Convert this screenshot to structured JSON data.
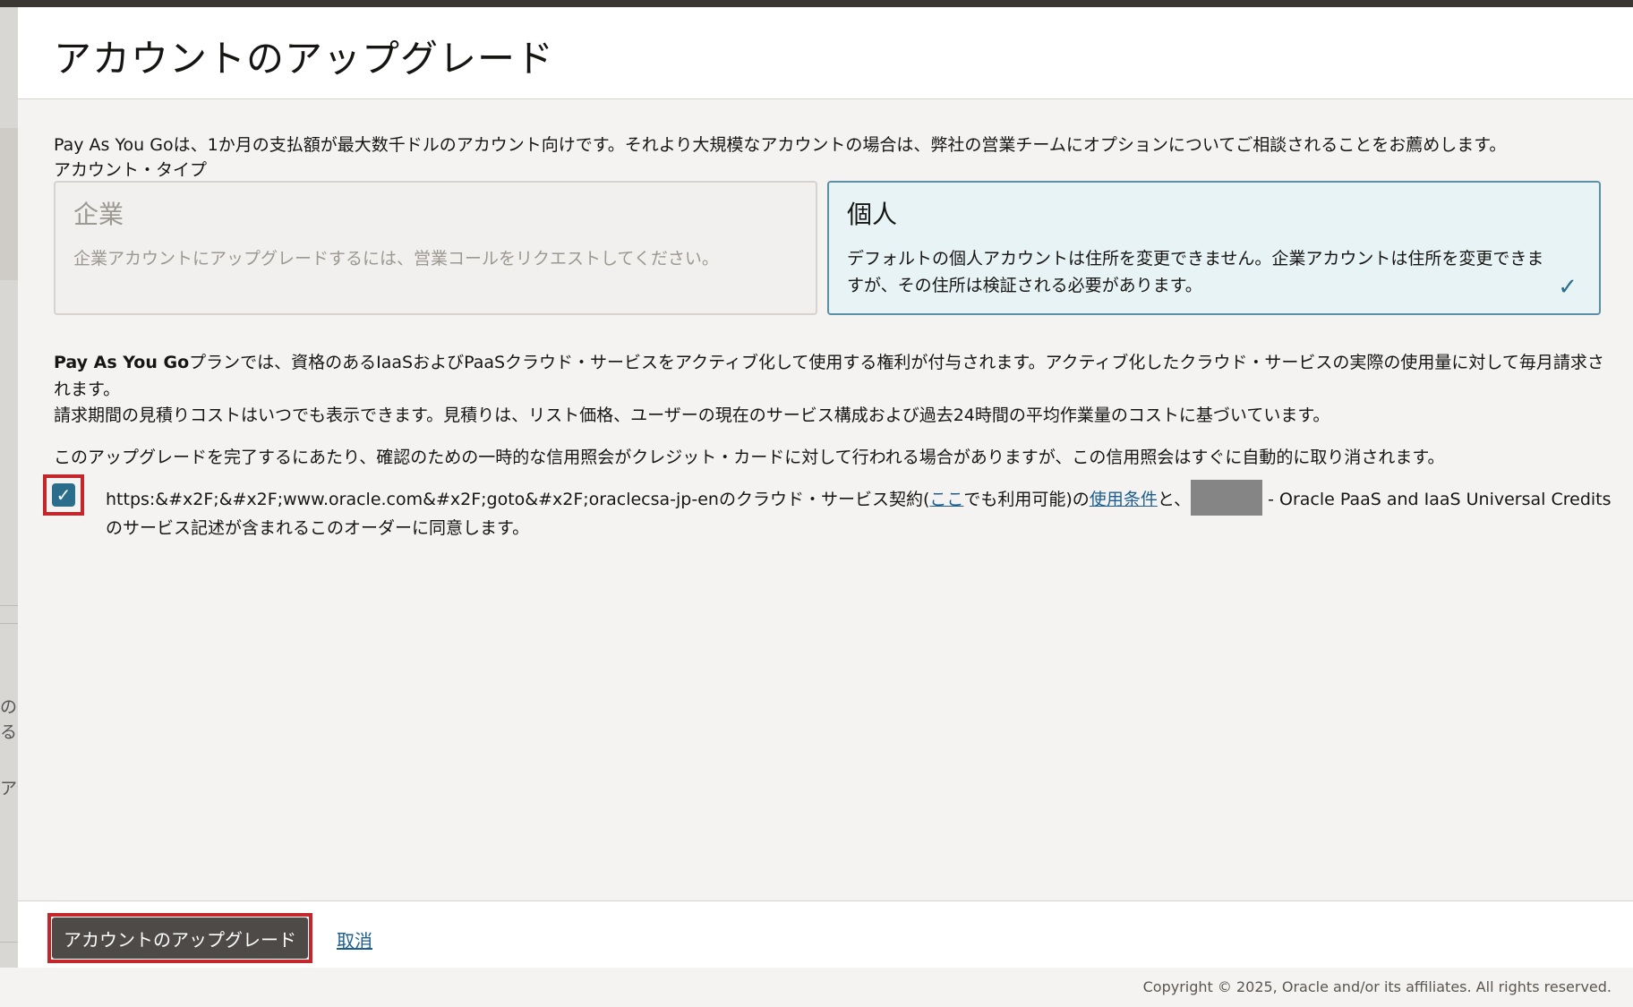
{
  "dialog": {
    "title": "アカウントのアップグレード",
    "intro": "Pay As You Goは、1か月の支払額が最大数千ドルのアカウント向けです。それより大規模なアカウントの場合は、弊社の営業チームにオプションについてご相談されることをお薦めします。",
    "account_type_label": "アカウント・タイプ"
  },
  "cards": {
    "enterprise": {
      "title": "企業",
      "description": "企業アカウントにアップグレードするには、営業コールをリクエストしてください。"
    },
    "individual": {
      "title": "個人",
      "description": "デフォルトの個人アカウントは住所を変更できません。企業アカウントは住所を変更できますが、その住所は検証される必要があります。",
      "selected_mark": "✓"
    }
  },
  "plan": {
    "bold": "Pay As You Go",
    "text": "プランでは、資格のあるIaaSおよびPaaSクラウド・サービスをアクティブ化して使用する権利が付与されます。アクティブ化したクラウド・サービスの実際の使用量に対して毎月請求されます。",
    "estimate": "請求期間の見積りコストはいつでも表示できます。見積りは、リスト価格、ユーザーの現在のサービス構成および過去24時間の平均作業量のコストに基づいています。",
    "credit_note": "このアップグレードを完了するにあたり、確認のための一時的な信用照会がクレジット・カードに対して行われる場合がありますが、この信用照会はすぐに自動的に取り消されます。"
  },
  "agreement": {
    "checked": true,
    "checkmark": "✓",
    "part1": "https:&#x2F;&#x2F;www.oracle.com&#x2F;goto&#x2F;oraclecsa-jp-enのクラウド・サービス契約(",
    "link_here": "ここ",
    "part2": "でも利用可能)の",
    "link_terms": "使用条件",
    "part3": "と、",
    "part4": " - Oracle PaaS and IaaS Universal Creditsのサービス記述が含まれるこのオーダーに同意します。"
  },
  "footer": {
    "upgrade_button": "アカウントのアップグレード",
    "cancel_link": "取消",
    "copyright": "Copyright © 2025, Oracle and/or its affiliates. All rights reserved."
  },
  "backdrop": {
    "frag1": "のア",
    "frag2": "るこ",
    "frag3": "アセ"
  },
  "colors": {
    "selected_border": "#5c8ea5",
    "selected_bg": "#e8f3f6",
    "link": "#1d5e8e",
    "highlight": "#c3272b",
    "primary_button": "#4d4a47"
  }
}
